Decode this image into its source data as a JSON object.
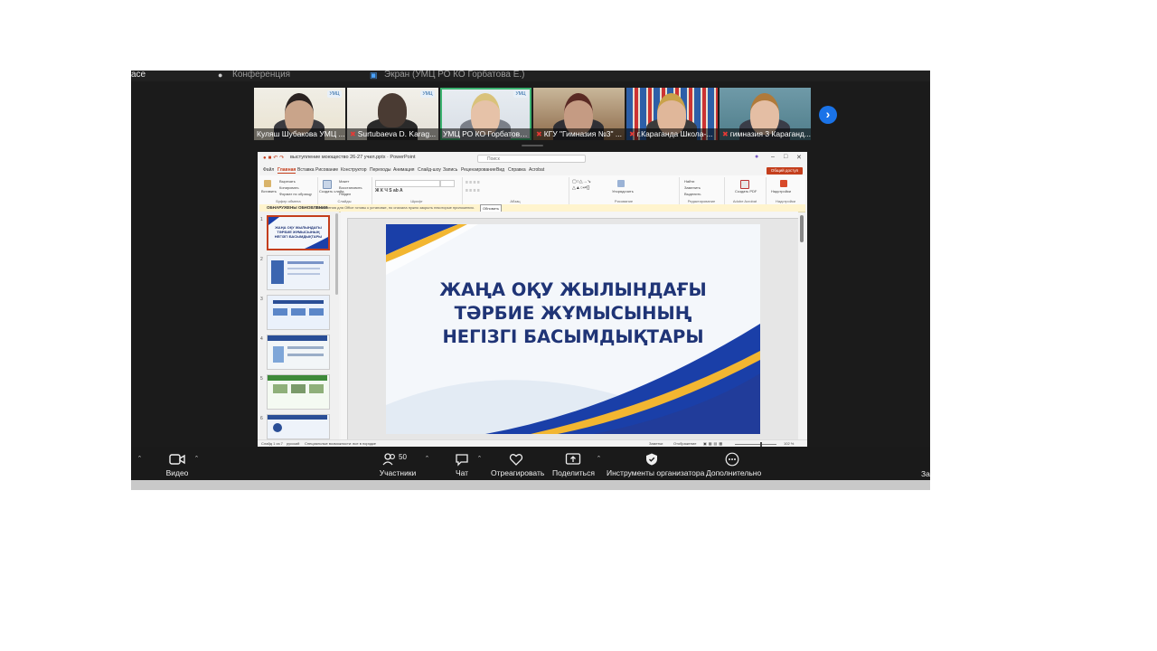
{
  "tabs": {
    "left_text": "ace",
    "item2": "Конференция",
    "item3": "Экран (УМЦ РО КО Горбатова Е.)"
  },
  "gallery": {
    "participants": [
      {
        "name": "Куляш Шубакова УМЦ ...",
        "muted": false
      },
      {
        "name": "Surtubaeva D. Karag...",
        "muted": true
      },
      {
        "name": "УМЦ РО КО Горбатова ...",
        "muted": false
      },
      {
        "name": "КГУ \"Гимназия №3\" ...",
        "muted": true
      },
      {
        "name": "г.Караганда Школа-...",
        "muted": true
      },
      {
        "name": "гимназия 3 Караганд...",
        "muted": true
      }
    ]
  },
  "ppt": {
    "filename": "выступление моющество 26-27 учил.pptx  ·  PowerPoint",
    "search_placeholder": "Поиск",
    "menu": [
      "Файл",
      "Главная",
      "Вставка",
      "Рисование",
      "Конструктор",
      "Переходы",
      "Анимация",
      "Слайд-шоу",
      "Запись",
      "Рецензирование",
      "Вид",
      "Справка",
      "Acrobat"
    ],
    "active_menu": "Главная",
    "share_label": "Общий доступ",
    "ribbon_groups": [
      "Буфер обмена",
      "Слайды",
      "Шрифт",
      "Абзац",
      "Рисование",
      "Редактирование",
      "Adobe Acrobat",
      "Надстройки"
    ],
    "ribbon_buttons": {
      "paste": "Вставить",
      "cut": "Вырезать",
      "copy": "Копировать",
      "format": "Формат по образцу",
      "new_slide": "Создать слайд",
      "layout": "Макет",
      "reset": "Восстановить",
      "section": "Раздел",
      "arrange": "Упорядочить",
      "find": "Найти",
      "replace": "Заменить",
      "select": "Выделить",
      "create_pdf": "Создать PDF",
      "addins": "Надстройки"
    },
    "update_bar": {
      "title": "ОБНАРУЖЕНЫ ОБНОВЛЕНИЯ",
      "text": "Обновления для Office готовы к установке, но сначала нужно закрыть некоторые приложения.",
      "button": "Обновить"
    },
    "thumb_numbers": [
      "1",
      "2",
      "3",
      "4",
      "5",
      "6"
    ],
    "slide_title_lines": [
      "ЖАҢА ОҚУ ЖЫЛЫНДАҒЫ",
      "ТӘРБИЕ ЖҰМЫСЫНЫҢ",
      "НЕГІЗГІ БАСЫМДЫҚТАРЫ"
    ],
    "thumb1_title": "ЖАҢА ОҚУ ЖЫЛЫНДАҒЫ ТӘРБИЕ ЖҰМЫСЫНЫҢ НЕГІЗГІ БАСЫМДЫҚТАРЫ",
    "status": {
      "slide": "Слайд 1 из 7",
      "language": "русский",
      "accessibility": "Специальные возможности: все в порядке",
      "notes": "Заметки",
      "display": "Отображение",
      "zoom": "102 %"
    }
  },
  "toolbar": {
    "video": "Видео",
    "participants": "Участники",
    "participants_count": "50",
    "chat": "Чат",
    "react": "Отреагировать",
    "share": "Поделиться",
    "host_tools": "Инструменты организатора",
    "more": "Дополнительно",
    "end_partial": "За"
  },
  "colors": {
    "title_navy": "#1f3476",
    "slide_blue": "#1a3fa8",
    "slide_gold": "#f2b631",
    "ppt_accent": "#c43e1c",
    "active_speaker": "#3cb371",
    "next_button": "#1a73e8"
  }
}
